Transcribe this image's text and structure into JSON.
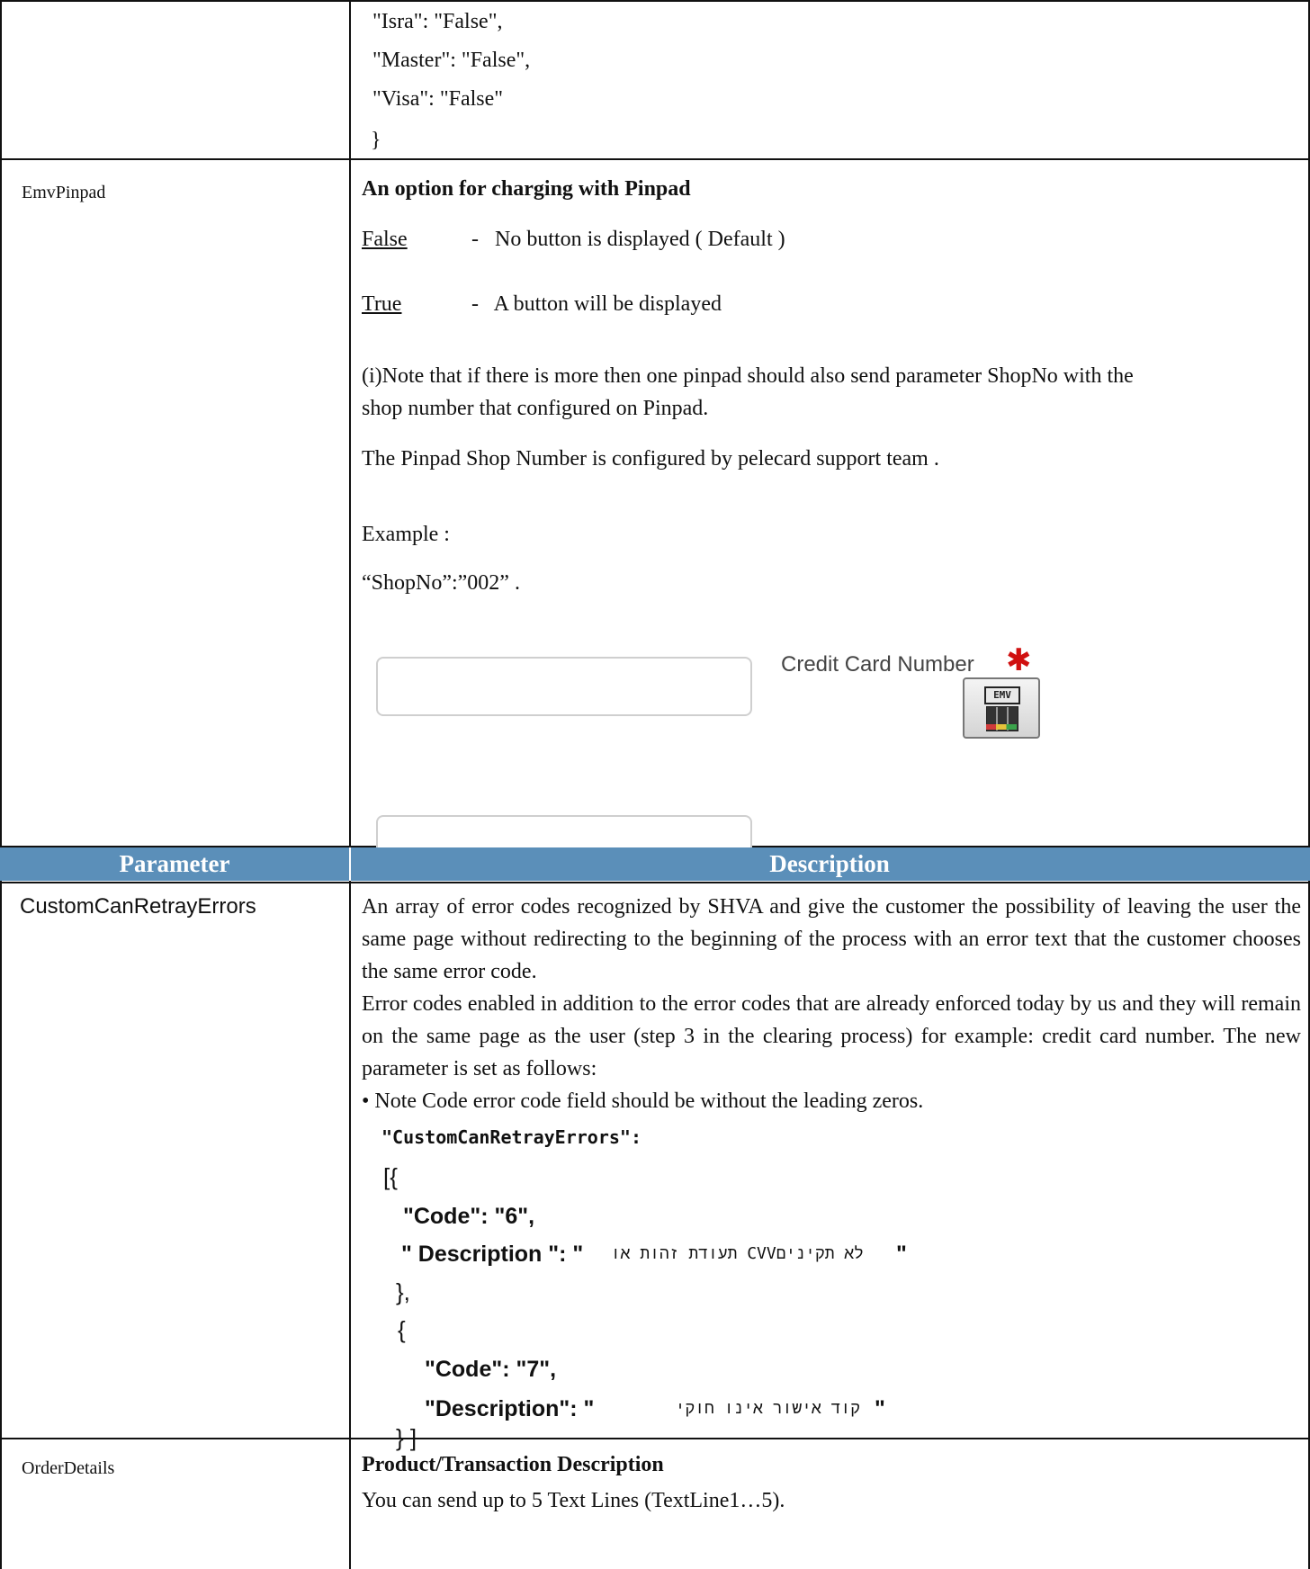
{
  "top_code": {
    "lines": [
      "\"Isra\": \"False\",",
      "\"Master\": \"False\",",
      "\"Visa\": \"False\"",
      "}"
    ]
  },
  "emv": {
    "param": "EmvPinpad",
    "title": "An option for charging with Pinpad",
    "opt_false_key": "False",
    "opt_false_desc": "-   No button is displayed ( Default )",
    "opt_true_key": "True",
    "opt_true_desc": "-   A button will be displayed",
    "note_line1": "(i)Note that if there is more then one pinpad should also send parameter ShopNo with the",
    "note_line2": "shop number that configured on Pinpad.",
    "note_line3": "The Pinpad Shop Number is configured by pelecard support team .",
    "example_label": "Example :",
    "example_value": "“ShopNo”:”002” .",
    "screenshot_label": "Credit Card Number",
    "emv_button_text": "EMV"
  },
  "header": {
    "parameter": "Parameter",
    "description": "Description"
  },
  "custom": {
    "param": "CustomCanRetrayErrors",
    "p1": "An array of error codes recognized by SHVA and give the customer the possibility of leaving the user the same page without redirecting to the beginning of the process with an error text that the customer chooses the same error code.",
    "p2": "Error codes enabled in addition to the error codes that are already enforced today by us and they will remain on the same page as the user (step 3 in the clearing process) for example: credit card number.  The new parameter is set as follows:",
    "bullet": "• Note Code error code field should be without the leading zeros.",
    "code_key": "\"CustomCanRetrayErrors\":",
    "code_open": "[{",
    "code_c1": "\"Code\": \"6\",",
    "code_d1_key": "\" Description \": \"",
    "code_d1_val": "לא תקיניםCVV תעודת זהות או",
    "code_d1_end": "\"",
    "code_mid_close": "},",
    "code_mid_open": "{",
    "code_c2": "\"Code\": \"7\",",
    "code_d2_key": "\"Description\": \"",
    "code_d2_val": "קוד אישור אינו חוקי",
    "code_d2_end": "\"",
    "code_close": "} ]"
  },
  "order": {
    "param": "OrderDetails",
    "title": "Product/Transaction Description",
    "line": "You can send up to 5 Text Lines (TextLine1…5)."
  }
}
